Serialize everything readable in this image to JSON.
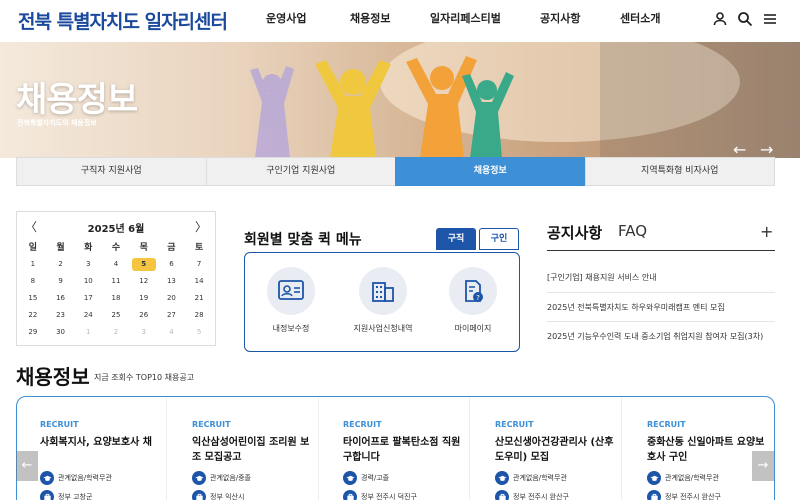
{
  "header": {
    "logo_prefix": "전북",
    "logo_rest": " 특별자치도 일자리센터",
    "nav": [
      "운영사업",
      "채용정보",
      "일자리페스티벌",
      "공지사항",
      "센터소개"
    ]
  },
  "hero": {
    "title": "채용정보",
    "subtitle": "전북특별자치도의 채용정보",
    "prev": "←",
    "next": "→"
  },
  "subtabs": [
    {
      "label": "구직자 지원사업",
      "active": false
    },
    {
      "label": "구인기업 지원사업",
      "active": false
    },
    {
      "label": "채용정보",
      "active": true
    },
    {
      "label": "지역특화형 비자사업",
      "active": false
    }
  ],
  "calendar": {
    "title": "2025년 6월",
    "prev": "〈",
    "next": "〉",
    "weekdays": [
      "일",
      "월",
      "화",
      "수",
      "목",
      "금",
      "토"
    ],
    "today": "5",
    "weeks": [
      [
        "1",
        "2",
        "3",
        "4",
        "5",
        "6",
        "7"
      ],
      [
        "8",
        "9",
        "10",
        "11",
        "12",
        "13",
        "14"
      ],
      [
        "15",
        "16",
        "17",
        "18",
        "19",
        "20",
        "21"
      ],
      [
        "22",
        "23",
        "24",
        "25",
        "26",
        "27",
        "28"
      ],
      [
        "29",
        "30",
        "1",
        "2",
        "3",
        "4",
        "5"
      ]
    ]
  },
  "quick_menu": {
    "title": "회원별 맞춤 퀵 메뉴",
    "tab_seeker": "구직",
    "tab_employer": "구인",
    "items": [
      "내정보수정",
      "지원사업신청내역",
      "마이페이지"
    ]
  },
  "notice": {
    "title": "공지사항",
    "faq": "FAQ",
    "plus": "+",
    "items": [
      "[구인기업] 채용지원 서비스 안내",
      "2025년 전북특별자치도 하우와우미래캠프 멘티 모집",
      "2025년 기능우수인력 도내 중소기업 취업지원 참여자 모집(3차)"
    ]
  },
  "jobs": {
    "title": "채용정보",
    "subtitle": "지금 조회수 TOP10 채용공고",
    "prev": "←",
    "next": "→",
    "items": [
      {
        "tag": "RECRUIT",
        "title": "사회복지사, 요양보호사 채",
        "meta1": "관계없음/학력무관",
        "meta2": "정부 고창군"
      },
      {
        "tag": "RECRUIT",
        "title": "익산삼성어린이집 조리원 보조 모집공고",
        "meta1": "관계없음/중졸",
        "meta2": "정부 익산시"
      },
      {
        "tag": "RECRUIT",
        "title": "타이어프로 팔복탄소점 직원 구합니다",
        "meta1": "경력/고졸",
        "meta2": "정부 전주시 덕진구"
      },
      {
        "tag": "RECRUIT",
        "title": "산모신생아건강관리사 (산후도우미) 모집",
        "meta1": "관계없음/학력무관",
        "meta2": "정부 전주시 완산구"
      },
      {
        "tag": "RECRUIT",
        "title": "중화산동 신일아파트 요양보호사 구인",
        "meta1": "관계없음/학력무관",
        "meta2": "정부 전주시 완산구"
      }
    ]
  }
}
